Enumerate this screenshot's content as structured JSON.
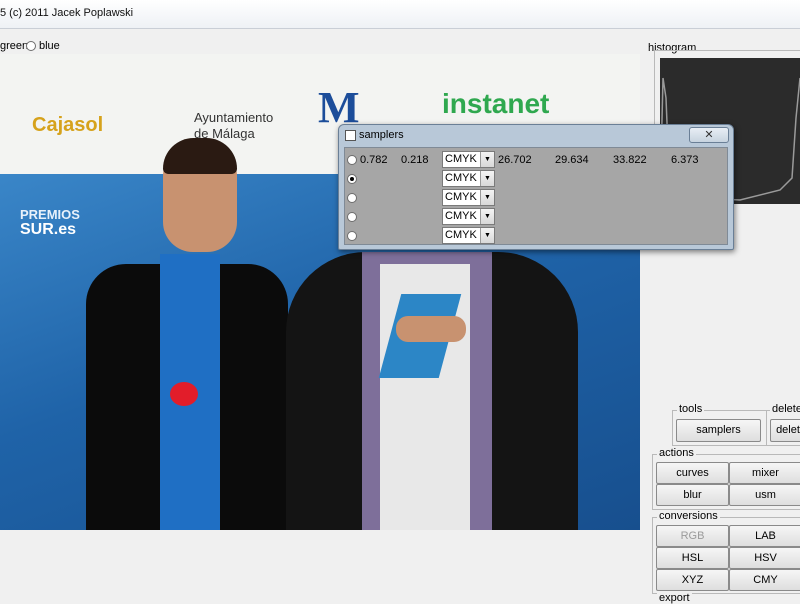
{
  "window": {
    "title": "5 (c) 2011 Jacek Poplawski"
  },
  "channel_selector": {
    "options": [
      {
        "label": "green"
      },
      {
        "label": "blue"
      }
    ]
  },
  "photo": {
    "banner_texts": [
      "Cajasol",
      "Ayuntamiento",
      "de Málaga",
      "instanet",
      "PREMIOS",
      "SUR.es"
    ]
  },
  "histogram": {
    "label": "histogram"
  },
  "tools": {
    "label": "tools",
    "samplers_button": "samplers"
  },
  "delete": {
    "label": "delete",
    "delete_button": "delet"
  },
  "actions": {
    "label": "actions",
    "buttons": [
      "curves",
      "mixer",
      "blur",
      "usm"
    ]
  },
  "conversions": {
    "label": "conversions",
    "buttons": [
      "RGB",
      "LAB",
      "HSL",
      "HSV",
      "XYZ",
      "CMY"
    ]
  },
  "export": {
    "label": "export"
  },
  "samplers_dialog": {
    "title": "samplers",
    "close_glyph": "✕",
    "rows": [
      {
        "x": "0.782",
        "y": "0.218",
        "mode": "CMYK",
        "c1": "26.702",
        "c2": "29.634",
        "c3": "33.822",
        "c4": "6.373"
      },
      {
        "mode": "CMYK"
      },
      {
        "mode": "CMYK"
      },
      {
        "mode": "CMYK"
      },
      {
        "mode": "CMYK"
      }
    ]
  },
  "colors": {
    "accent_dialog": "#b8c8d8",
    "histogram_bg": "#2b2b2b"
  }
}
